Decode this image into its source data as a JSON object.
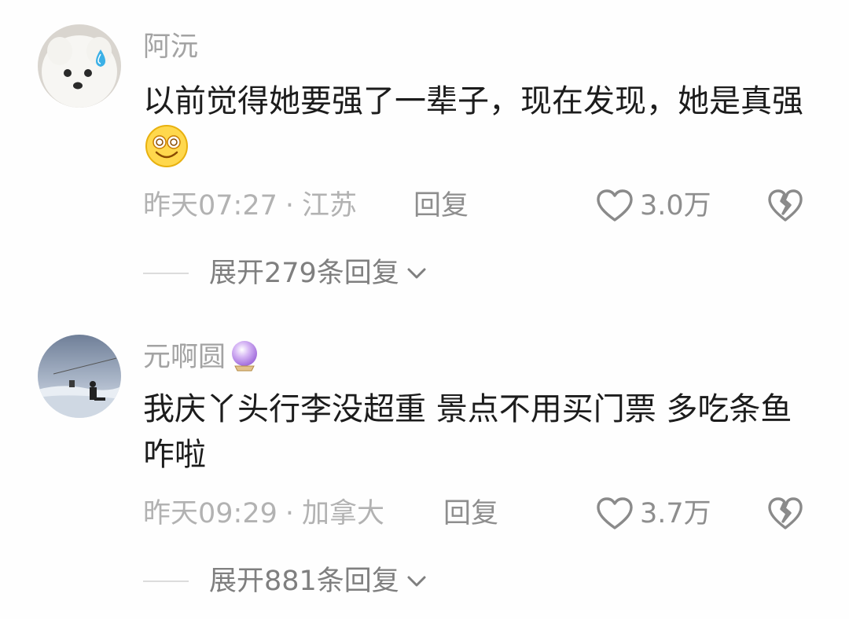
{
  "comments": [
    {
      "username": "阿沅",
      "avatar_icon": "white-pomeranian-sweat-drop-avatar",
      "content": "以前觉得她要强了一辈子，现在发现，她是真强",
      "content_emoji": "dizzy-smile-emoji",
      "time": "昨天07:27",
      "location": "江苏",
      "reply_label": "回复",
      "likes": "3.0万",
      "expand_label": "展开279条回复"
    },
    {
      "username": "元啊圆",
      "username_badge": "crystal-ball-emoji",
      "avatar_icon": "snowy-landscape-avatar",
      "content": "我庆丫头行李没超重 景点不用买门票 多吃条鱼咋啦",
      "time": "昨天09:29",
      "location": "加拿大",
      "reply_label": "回复",
      "likes": "3.7万",
      "expand_label": "展开881条回复"
    }
  ],
  "separator": "·"
}
